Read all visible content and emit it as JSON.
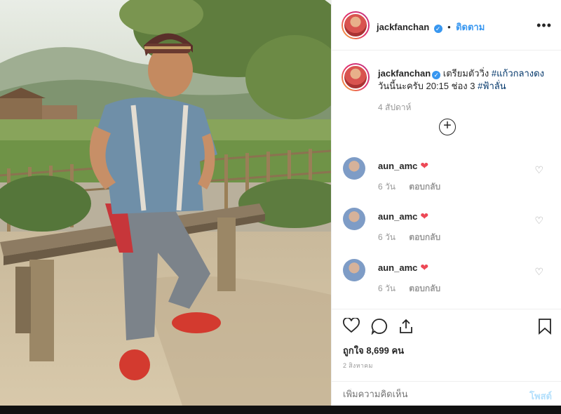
{
  "header": {
    "username": "jackfanchan",
    "separator": "•",
    "follow_label": "ติดตาม",
    "more_icon": "more-horizontal-icon"
  },
  "caption": {
    "username": "jackfanchan",
    "text": "เตรียมตัววิ่ง",
    "hashtag1": "#แก้วกลางดง",
    "text2": "วันนี้นะครับ 20:15 ช่อง 3",
    "hashtag2": "#ฟ้าลั่น",
    "time_ago": "4 สัปดาห์"
  },
  "comments": [
    {
      "username": "aun_amc",
      "time": "6 วัน",
      "reply_label": "ตอบกลับ"
    },
    {
      "username": "aun_amc",
      "time": "6 วัน",
      "reply_label": "ตอบกลับ"
    },
    {
      "username": "aun_amc",
      "time": "6 วัน",
      "reply_label": "ตอบกลับ"
    }
  ],
  "actions": {
    "likes_text": "ถูกใจ 8,699 คน",
    "date": "2 สิงหาคม"
  },
  "comment_bar": {
    "placeholder": "เพิ่มความคิดเห็น",
    "post_label": "โพสต์"
  }
}
